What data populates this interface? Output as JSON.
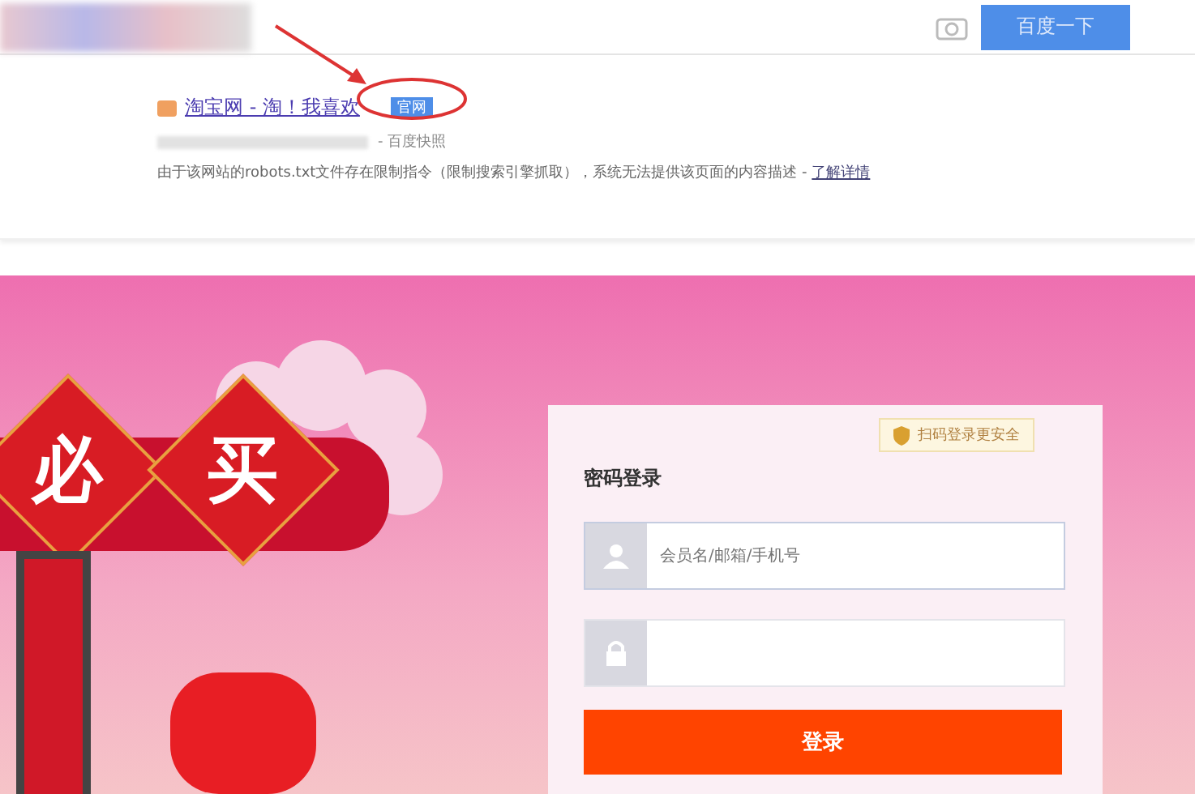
{
  "search_bar": {
    "button": "百度一下"
  },
  "result": {
    "title": "淘宝网 - 淘！我喜欢",
    "badge": "官网",
    "meta": "- 百度快照",
    "description": "由于该网站的robots.txt文件存在限制指令（限制搜索引擎抓取），系统无法提供该页面的内容描述 - ",
    "link": "了解详情"
  },
  "banner": {
    "characters": [
      "必",
      "买"
    ]
  },
  "login": {
    "notice": "扫码登录更安全",
    "title": "密码登录",
    "fields": [
      {
        "kind": "user",
        "placeholder": "会员名/邮箱/手机号"
      },
      {
        "kind": "password"
      }
    ],
    "button": "登录"
  }
}
